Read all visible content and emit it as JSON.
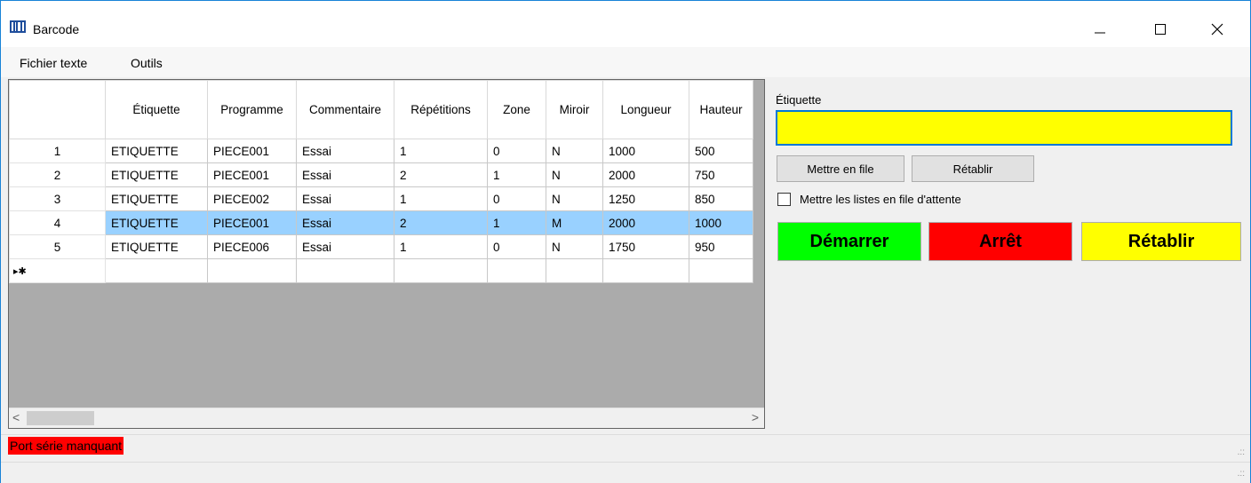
{
  "window": {
    "title": "Barcode",
    "minimize": "—",
    "maximize": "☐",
    "close": "✕"
  },
  "menu": {
    "items": [
      "Fichier texte",
      "Outils"
    ]
  },
  "grid": {
    "columns": [
      "",
      "Étiquette",
      "Programme",
      "Commentaire",
      "Répétitions",
      "Zone",
      "Miroir",
      "Longueur",
      "Hauteur"
    ],
    "rows": [
      [
        "1",
        "ETIQUETTE",
        "PIECE001",
        "Essai",
        "1",
        "0",
        "N",
        "1000",
        "500"
      ],
      [
        "2",
        "ETIQUETTE",
        "PIECE001",
        "Essai",
        "2",
        "1",
        "N",
        "2000",
        "750"
      ],
      [
        "3",
        "ETIQUETTE",
        "PIECE002",
        "Essai",
        "1",
        "0",
        "N",
        "1250",
        "850"
      ],
      [
        "4",
        "ETIQUETTE",
        "PIECE001",
        "Essai",
        "2",
        "1",
        "M",
        "2000",
        "1000"
      ],
      [
        "5",
        "ETIQUETTE",
        "PIECE006",
        "Essai",
        "1",
        "0",
        "N",
        "1750",
        "950"
      ]
    ],
    "selected_row": 3,
    "new_row_marker": "▸✱",
    "scroll_left": "<",
    "scroll_right": ">"
  },
  "panel": {
    "etiquette_label": "Étiquette",
    "etiquette_value": "",
    "queue_button": "Mettre en file",
    "reset_small_button": "Rétablir",
    "checkbox_label": "Mettre les listes en file d'attente",
    "start_button": "Démarrer",
    "stop_button": "Arrêt",
    "reset_button": "Rétablir",
    "colors": {
      "input": "#ffff00",
      "start": "#00ff00",
      "stop": "#ff0000",
      "reset": "#ffff00"
    }
  },
  "status": {
    "message": "Port série manquant",
    "grip": ".::"
  }
}
